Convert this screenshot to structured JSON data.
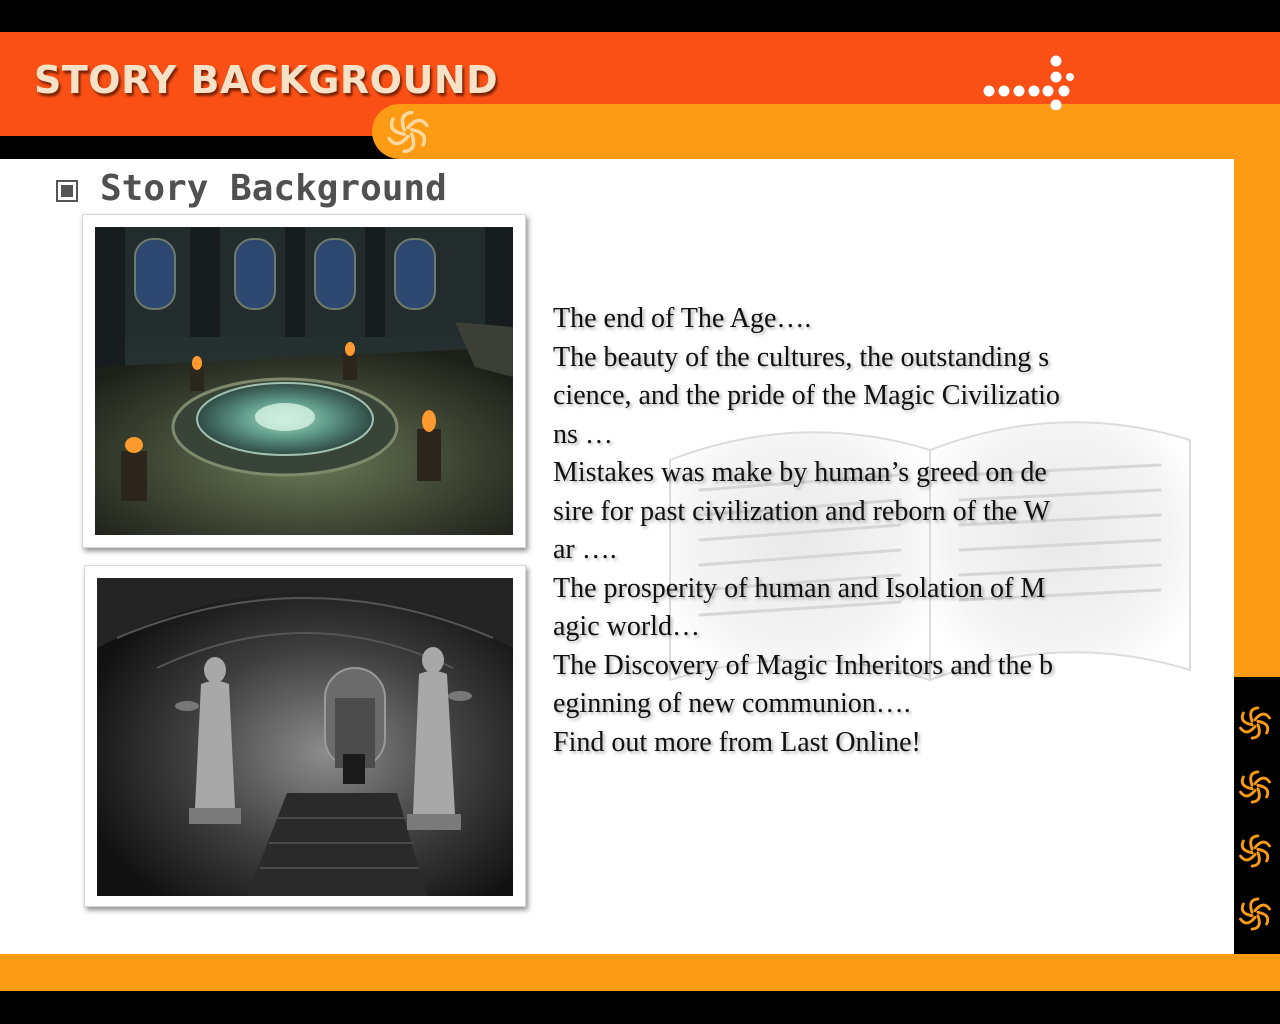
{
  "slide": {
    "title": "STORY BACKGROUND",
    "section_heading": "Story Background"
  },
  "story_lines": [
    "The end of The Age….",
    "The beauty of the cultures, the outstanding s",
    "cience, and the pride of the Magic Civilizatio",
    "ns …",
    "Mistakes was make by human’s greed on de",
    "sire for past civilization and reborn of the W",
    "ar ….",
    "The prosperity of human and Isolation of M",
    "agic world…",
    "The Discovery of Magic Inheritors and the b",
    "eginning of new communion….",
    "Find out more from Last Online!"
  ],
  "images": [
    {
      "name": "temple-hall-screenshot"
    },
    {
      "name": "statue-chamber-screenshot"
    }
  ],
  "colors": {
    "header_red": "#fb5015",
    "accent_orange": "#fd9b14",
    "title_text": "#f7e2c8",
    "heading_gray": "#505050"
  },
  "icons": [
    "swirl-icon",
    "dots-ornament-icon",
    "square-bullet-icon"
  ]
}
